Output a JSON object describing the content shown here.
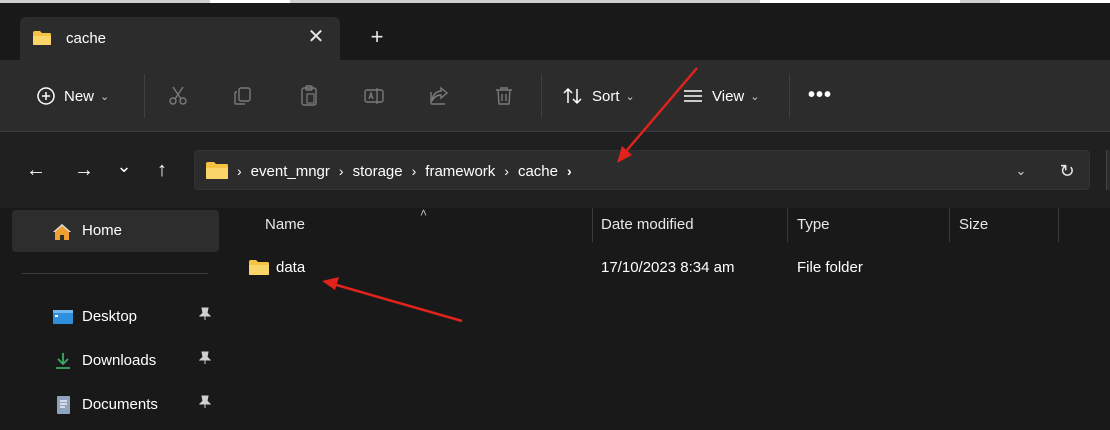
{
  "tab": {
    "title": "cache",
    "close_glyph": "✕",
    "new_tab_glyph": "+"
  },
  "toolbar": {
    "new_label": "New",
    "sort_label": "Sort",
    "view_label": "View",
    "more_glyph": "•••",
    "icons": [
      "plus-circle-icon",
      "cut-icon",
      "copy-icon",
      "paste-icon",
      "rename-icon",
      "share-icon",
      "delete-icon",
      "sort-icon",
      "view-list-icon"
    ]
  },
  "nav": {
    "back_glyph": "←",
    "forward_glyph": "→",
    "recent_glyph": "⌄",
    "up_glyph": "↑",
    "breadcrumb": [
      "event_mngr",
      "storage",
      "framework",
      "cache"
    ],
    "crumb_sep": "›",
    "dropdown_glyph": "⌄",
    "refresh_glyph": "↻"
  },
  "sidebar": {
    "home": {
      "label": "Home",
      "icon": "home-icon"
    },
    "items": [
      {
        "label": "Desktop",
        "icon": "desktop-icon",
        "pinned": true
      },
      {
        "label": "Downloads",
        "icon": "download-icon",
        "pinned": true
      },
      {
        "label": "Documents",
        "icon": "document-icon",
        "pinned": true
      }
    ],
    "pin_glyph": "📌"
  },
  "columns": {
    "sort_glyph": "˄",
    "headers": [
      "Name",
      "Date modified",
      "Type",
      "Size"
    ]
  },
  "files": [
    {
      "name": "data",
      "date_modified": "17/10/2023 8:34 am",
      "type": "File folder",
      "size": ""
    }
  ],
  "colors": {
    "window_bg": "#191919",
    "toolbar_bg": "#2c2c2c",
    "folder_yellow": "#f5c242",
    "annotation_red": "#e0231c"
  }
}
